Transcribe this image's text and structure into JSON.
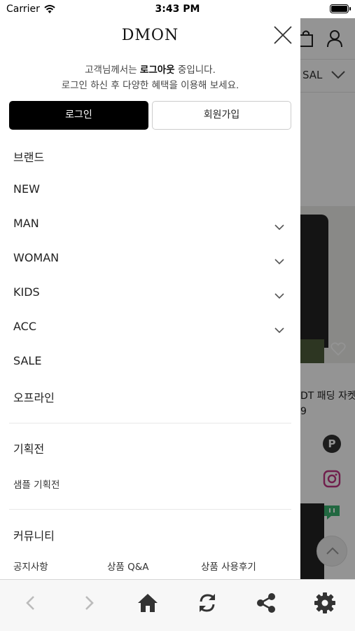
{
  "status_bar": {
    "carrier": "Carrier",
    "time": "3:43 PM"
  },
  "background": {
    "nav_sale": "SAL",
    "product_title": "DT 패딩 자켓",
    "product_price": "9"
  },
  "drawer": {
    "logo": "DMON",
    "greeting_prefix": "고객님께서는 ",
    "greeting_bold": "로그아웃",
    "greeting_suffix": " 중입니다.",
    "greeting_line2": "로그인 하신 후 다양한 혜택을 이용해 보세요.",
    "login_label": "로그인",
    "join_label": "회원가입",
    "menu": [
      {
        "label": "브랜드",
        "expandable": false
      },
      {
        "label": "NEW",
        "expandable": false
      },
      {
        "label": "MAN",
        "expandable": true
      },
      {
        "label": "WOMAN",
        "expandable": true
      },
      {
        "label": "KIDS",
        "expandable": true
      },
      {
        "label": "ACC",
        "expandable": true
      },
      {
        "label": "SALE",
        "expandable": false
      },
      {
        "label": "오프라인",
        "expandable": false
      }
    ],
    "promotions": {
      "title": "기획전",
      "links": [
        "샘플 기획전"
      ]
    },
    "community": {
      "title": "커뮤니티",
      "links": [
        "공지사항",
        "상품 Q&A",
        "상품 사용후기"
      ]
    }
  },
  "toolbar": {
    "icons": [
      "back-icon",
      "forward-icon",
      "home-icon",
      "refresh-icon",
      "share-icon",
      "settings-icon"
    ]
  },
  "colors": {
    "primary": "#000000",
    "accent_fab": "#333333"
  }
}
